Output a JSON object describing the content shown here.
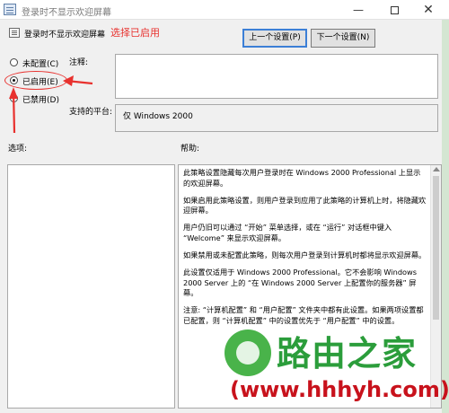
{
  "window": {
    "title": "登录时不显示欢迎屏幕",
    "controls": {
      "minimize": "—",
      "close": "✕"
    }
  },
  "header": {
    "setting_title": "登录时不显示欢迎屏幕",
    "annotation": "选择已启用",
    "prev_button": "上一个设置(P)",
    "next_button": "下一个设置(N)"
  },
  "options": {
    "not_configured": "未配置(C)",
    "enabled": "已启用(E)",
    "disabled": "已禁用(D)",
    "selected": "enabled"
  },
  "comment": {
    "label": "注释:",
    "value": ""
  },
  "platform": {
    "label": "支持的平台:",
    "value": "仅 Windows 2000"
  },
  "panes": {
    "options_label": "选项:",
    "help_label": "帮助:"
  },
  "help": {
    "paragraphs": [
      "此策略设置隐藏每次用户登录时在 Windows 2000 Professional 上显示的欢迎屏幕。",
      "如果启用此策略设置，则用户登录到应用了此策略的计算机上时，将隐藏欢迎屏幕。",
      "用户仍旧可以通过 “开始” 菜单选择，或在 “运行” 对话框中键入 “Welcome” 来显示欢迎屏幕。",
      "如果禁用或未配置此策略，则每次用户登录到计算机时都将显示欢迎屏幕。",
      "此设置仅适用于 Windows 2000 Professional。它不会影响 Windows 2000 Server 上的 “在 Windows 2000 Server 上配置你的服务器” 屏幕。",
      "注意: “计算机配置” 和 “用户配置” 文件夹中都有此设置。如果两项设置都已配置，则 “计算机配置” 中的设置优先于 “用户配置” 中的设置。"
    ]
  },
  "watermark": {
    "title": "路由之家",
    "url": "(www.hhhyh.com)"
  },
  "colors": {
    "annotation_red": "#e8312e",
    "focus_blue": "#3c7fd6",
    "watermark_green": "#2b9d3b",
    "watermark_red": "#c8121c"
  }
}
